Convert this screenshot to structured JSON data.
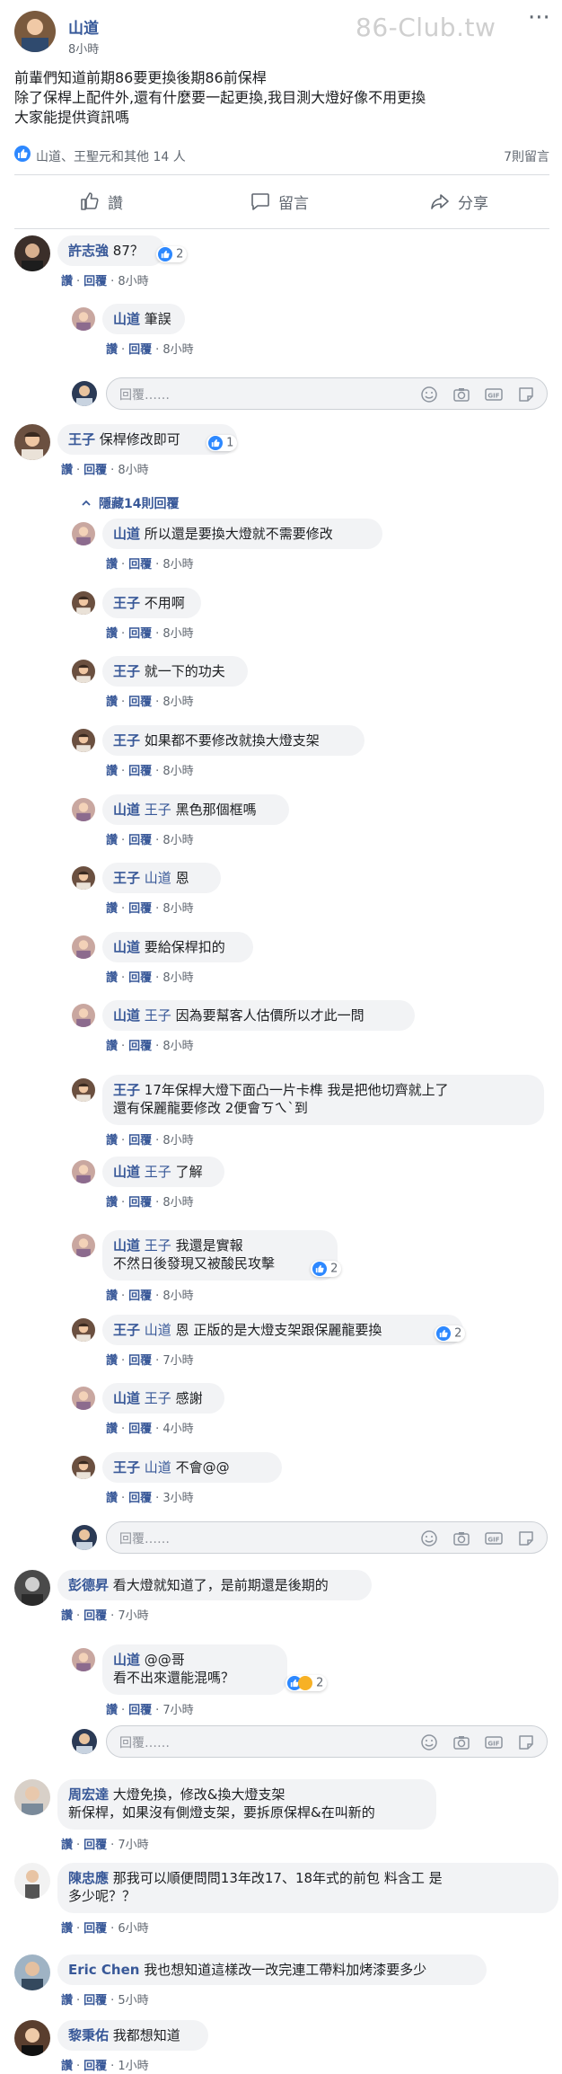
{
  "watermark": "86-Club.tw",
  "post": {
    "author": "山道",
    "time": "8小時",
    "body": [
      "前輩們知道前期86要更換後期86前保桿",
      "除了保桿上配件外,還有什麼要一起更換,我目測大燈好像不用更換",
      "大家能提供資訊嗎"
    ],
    "reactions_text": "山道、王聖元和其他 14 人",
    "comment_count": "7則留言",
    "actions": {
      "like": "讚",
      "comment": "留言",
      "share": "分享"
    }
  },
  "ui": {
    "like_label": "讚",
    "reply_label": "回覆",
    "reply_placeholder": "回覆……",
    "hide_replies": "隱藏14則回覆"
  },
  "comments": [
    {
      "name": "許志強",
      "text": "87？",
      "time": "8小時",
      "reactions": "2"
    },
    {
      "name": "山道",
      "text": "筆誤",
      "time": "8小時"
    },
    {
      "name": "王子",
      "text": "保桿修改即可",
      "time": "8小時",
      "reactions": "1"
    },
    {
      "name": "山道",
      "text": "所以還是要換大燈就不需要修改",
      "time": "8小時"
    },
    {
      "name": "王子",
      "text": "不用啊",
      "time": "8小時"
    },
    {
      "name": "王子",
      "text": "就一下的功夫",
      "time": "8小時"
    },
    {
      "name": "王子",
      "text": "如果都不要修改就換大燈支架",
      "time": "8小時"
    },
    {
      "name": "山道",
      "tag": "王子",
      "text": "黑色那個框嗎",
      "time": "8小時"
    },
    {
      "name": "王子",
      "tag": "山道",
      "text": "恩",
      "time": "8小時"
    },
    {
      "name": "山道",
      "text": "要給保桿扣的",
      "time": "8小時"
    },
    {
      "name": "山道",
      "tag": "王子",
      "text": "因為要幫客人估價所以才此一問",
      "time": "8小時"
    },
    {
      "name": "王子",
      "text": "17年保桿大燈下面凸一片卡榫 我是把他切齊就上了",
      "text2": "還有保麗龍要修改 2便會ㄎㄟˋ到",
      "time": "8小時"
    },
    {
      "name": "山道",
      "tag": "王子",
      "text": "了解",
      "time": "8小時"
    },
    {
      "name": "山道",
      "tag": "王子",
      "text": "我還是實報",
      "text2": "不然日後發現又被酸民攻擊",
      "time": "8小時",
      "reactions": "2"
    },
    {
      "name": "王子",
      "tag": "山道",
      "text": "恩 正版的是大燈支架跟保麗龍要換",
      "time": "7小時",
      "reactions": "2"
    },
    {
      "name": "山道",
      "tag": "王子",
      "text": "感謝",
      "time": "4小時"
    },
    {
      "name": "王子",
      "tag": "山道",
      "text": "不會@@",
      "time": "3小時"
    },
    {
      "name": "彭德昇",
      "text": "看大燈就知道了，是前期還是後期的",
      "time": "7小時"
    },
    {
      "name": "山道",
      "text": "@@哥",
      "text2": "看不出來還能混嗎？",
      "time": "7小時",
      "reactions": "2"
    },
    {
      "name": "周宏達",
      "text": "大燈免換，修改&換大燈支架",
      "text2": "新保桿，如果沒有側燈支架，要拆原保桿&在叫新的",
      "time": "7小時"
    },
    {
      "name": "陳忠應",
      "text": "那我可以順便問問13年改17、18年式的前包 料含工 是",
      "text2": "多少呢？？",
      "time": "6小時"
    },
    {
      "name": "Eric Chen",
      "text": "我也想知道這樣改一改完連工帶料加烤漆要多少",
      "time": "5小時"
    },
    {
      "name": "黎秉佑",
      "text": "我都想知道",
      "time": "1小時"
    }
  ],
  "colors": {
    "link": "#385898",
    "bubble": "#f2f3f5",
    "meta": "#606770",
    "like_blue": "#2d88ff"
  }
}
